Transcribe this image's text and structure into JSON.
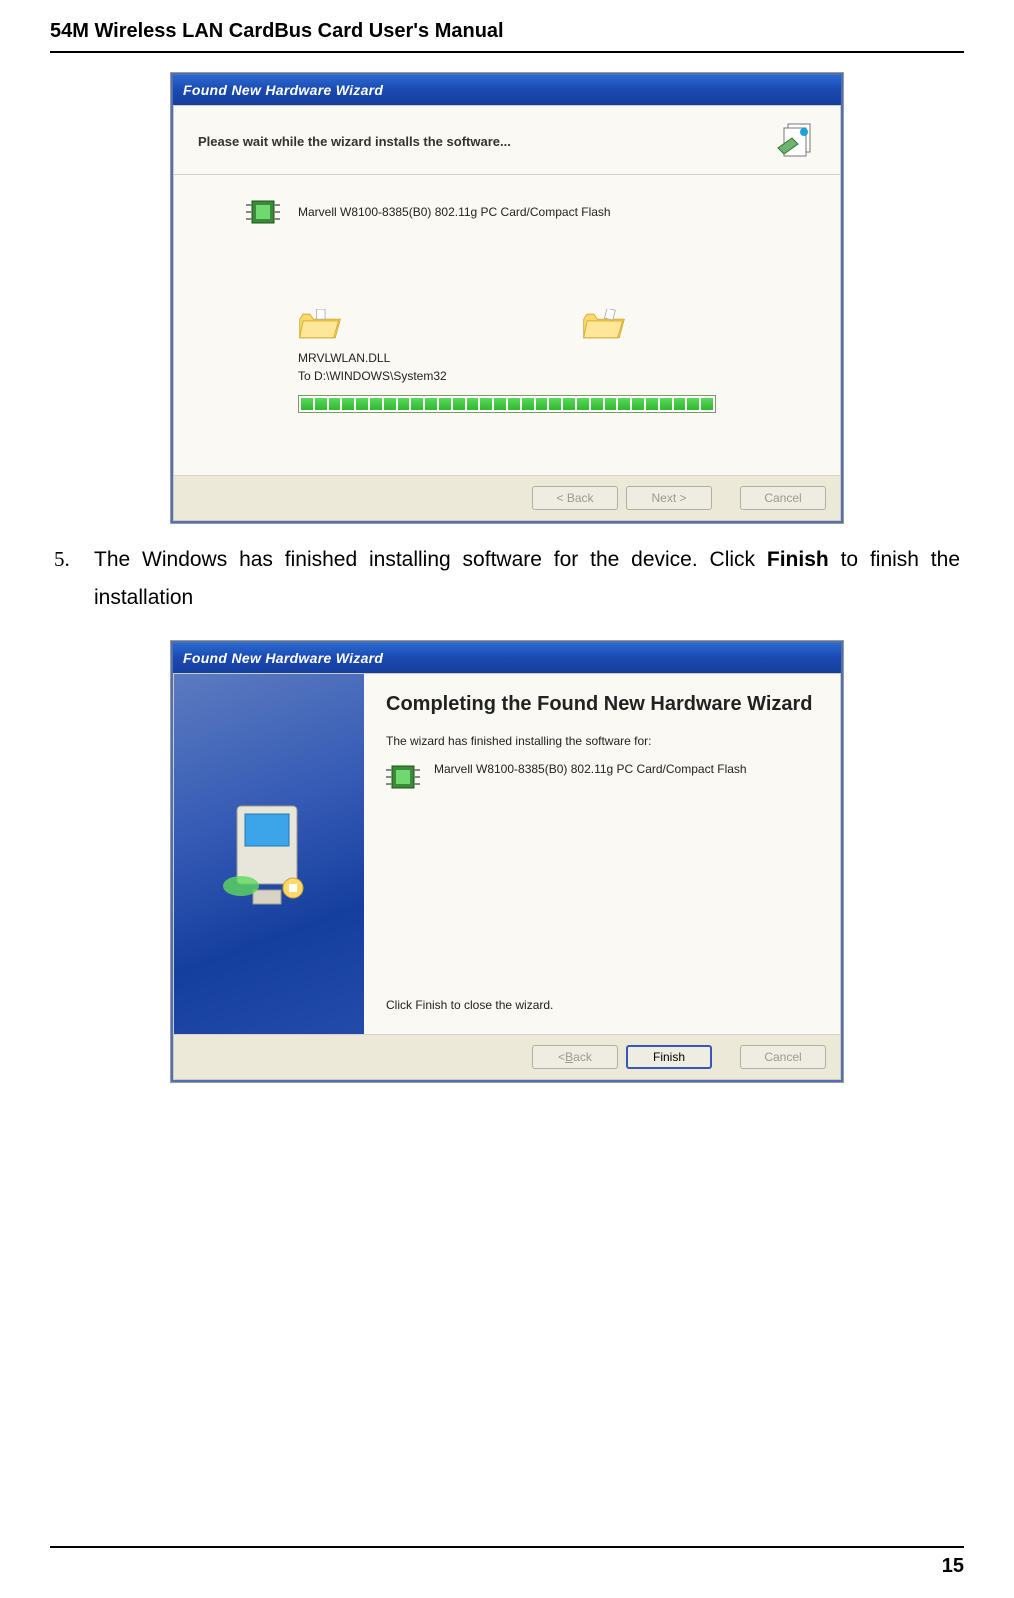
{
  "page": {
    "header": "54M Wireless LAN CardBus Card User's Manual",
    "number": "15"
  },
  "instruction": {
    "num": "5.",
    "pre": "The Windows has finished installing software for the device. Click ",
    "bold": "Finish",
    "post": " to finish the installation"
  },
  "dialog1": {
    "title": "Found New Hardware Wizard",
    "subtitle": "Please wait while the wizard installs the software...",
    "device": "Marvell W8100-8385(B0) 802.11g PC Card/Compact Flash",
    "file": "MRVLWLAN.DLL",
    "dest": "To D:\\WINDOWS\\System32",
    "buttons": {
      "back": "< Back",
      "next": "Next >",
      "cancel": "Cancel"
    }
  },
  "dialog2": {
    "title": "Found New Hardware Wizard",
    "heading": "Completing the Found New Hardware Wizard",
    "desc": "The wizard has finished installing the software for:",
    "device": "Marvell W8100-8385(B0) 802.11g PC Card/Compact Flash",
    "hint": "Click Finish to close the wizard.",
    "buttons": {
      "back_pre": "< ",
      "back_u": "B",
      "back_post": "ack",
      "finish": "Finish",
      "cancel": "Cancel"
    }
  }
}
